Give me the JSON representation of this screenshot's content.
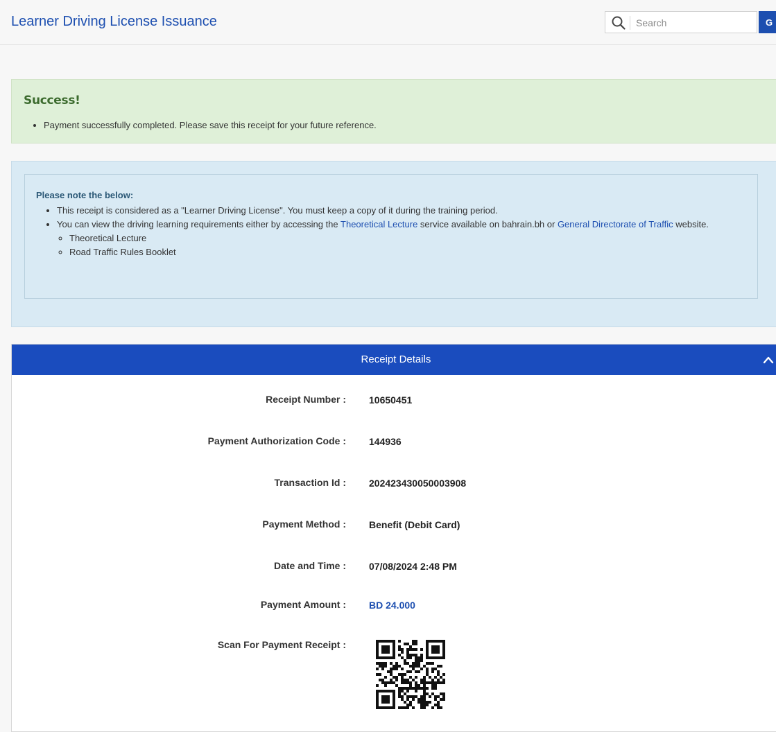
{
  "header": {
    "title": "Learner Driving License Issuance",
    "search_placeholder": "Search",
    "go_label": "G"
  },
  "success_alert": {
    "title": "Success!",
    "message": "Payment successfully completed. Please save this receipt for your future reference."
  },
  "note": {
    "heading": "Please note the below:",
    "item1": "This receipt is considered as a \"Learner Driving License\". You must keep a copy of it during the training period.",
    "item2_before": "You can view the driving learning requirements either by accessing the ",
    "item2_link1": "Theoretical Lecture",
    "item2_middle": " service available on bahrain.bh or ",
    "item2_link2": "General Directorate of Traffic",
    "item2_after": " website.",
    "sub_items": [
      "Theoretical Lecture",
      "Road Traffic Rules Booklet"
    ]
  },
  "receipt": {
    "title": "Receipt Details",
    "rows": [
      {
        "label": "Receipt Number :",
        "value": "10650451"
      },
      {
        "label": "Payment Authorization Code :",
        "value": "144936"
      },
      {
        "label": "Transaction Id :",
        "value": "202423430050003908"
      },
      {
        "label": "Payment Method :",
        "value": "Benefit (Debit Card)"
      },
      {
        "label": "Date and Time :",
        "value": "07/08/2024 2:48 PM"
      },
      {
        "label": "Payment Amount :",
        "value": "BD 24.000"
      }
    ],
    "qr_label": "Scan For Payment Receipt :"
  },
  "colors": {
    "brand_blue": "#1a4cbe",
    "success_bg": "#dff0d8",
    "info_bg": "#d9eaf4"
  },
  "icons": [
    "search-icon",
    "chevron-up-icon",
    "qr-code"
  ]
}
